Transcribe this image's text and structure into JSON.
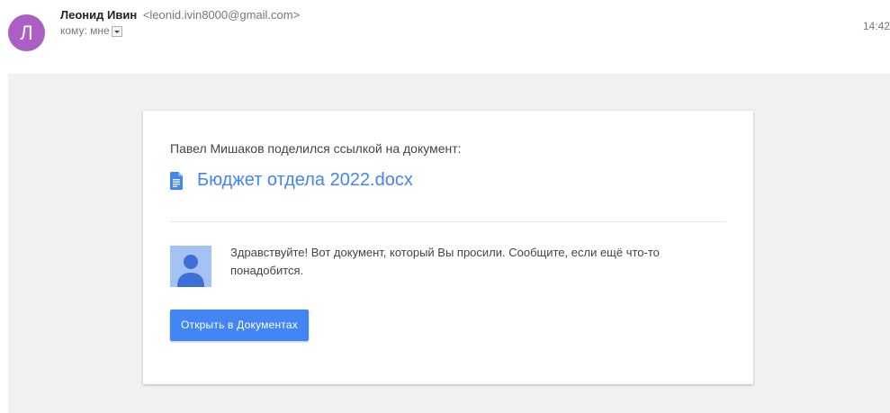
{
  "header": {
    "avatar_letter": "Л",
    "sender_name": "Леонид Ивин",
    "sender_email": "<leonid.ivin8000@gmail.com>",
    "to_label": "кому: мне",
    "time": "14:42"
  },
  "card": {
    "share_text": "Павел Мишаков поделился ссылкой на документ:",
    "doc_name": "Бюджет отдела 2022.docx",
    "message": "Здравствуйте! Вот документ, который Вы просили. Сообщите, если ещё что-то понадобится.",
    "open_button_label": "Открыть в Документах"
  },
  "colors": {
    "avatar": "#ab5fc5",
    "link": "#4285f4",
    "button": "#4285f4",
    "background": "#f1f1f1"
  },
  "icons": {
    "dropdown": "chevron-down-icon",
    "doc": "google-docs-icon",
    "person": "person-icon"
  }
}
